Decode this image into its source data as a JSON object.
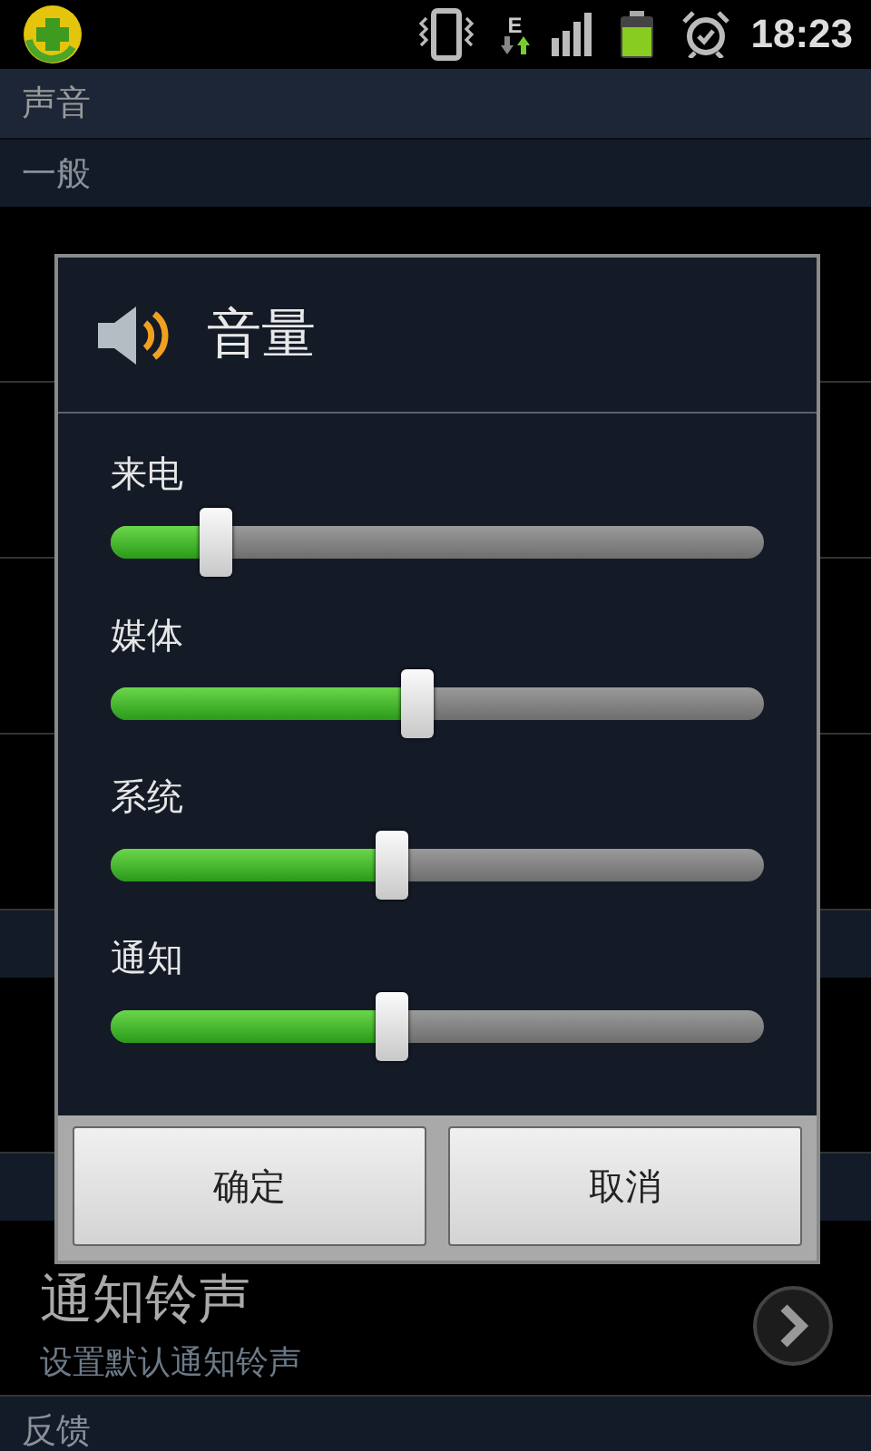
{
  "status_bar": {
    "network": "E",
    "time": "18:23"
  },
  "screen_title": "声音",
  "list": [
    {
      "kind": "header",
      "title": "一般"
    },
    {
      "kind": "item"
    },
    {
      "kind": "item"
    },
    {
      "kind": "item"
    },
    {
      "kind": "item"
    },
    {
      "kind": "header"
    },
    {
      "kind": "item"
    },
    {
      "kind": "header"
    },
    {
      "kind": "item",
      "title": "通知铃声",
      "summary": "设置默认通知铃声",
      "has_arrow": true
    },
    {
      "kind": "header",
      "title": "反馈"
    }
  ],
  "dialog": {
    "title": "音量",
    "sliders": [
      {
        "label": "来电",
        "level": 0.16
      },
      {
        "label": "媒体",
        "level": 0.47
      },
      {
        "label": "系统",
        "level": 0.43
      },
      {
        "label": "通知",
        "level": 0.43
      }
    ],
    "buttons": [
      "确定",
      "取消"
    ]
  }
}
